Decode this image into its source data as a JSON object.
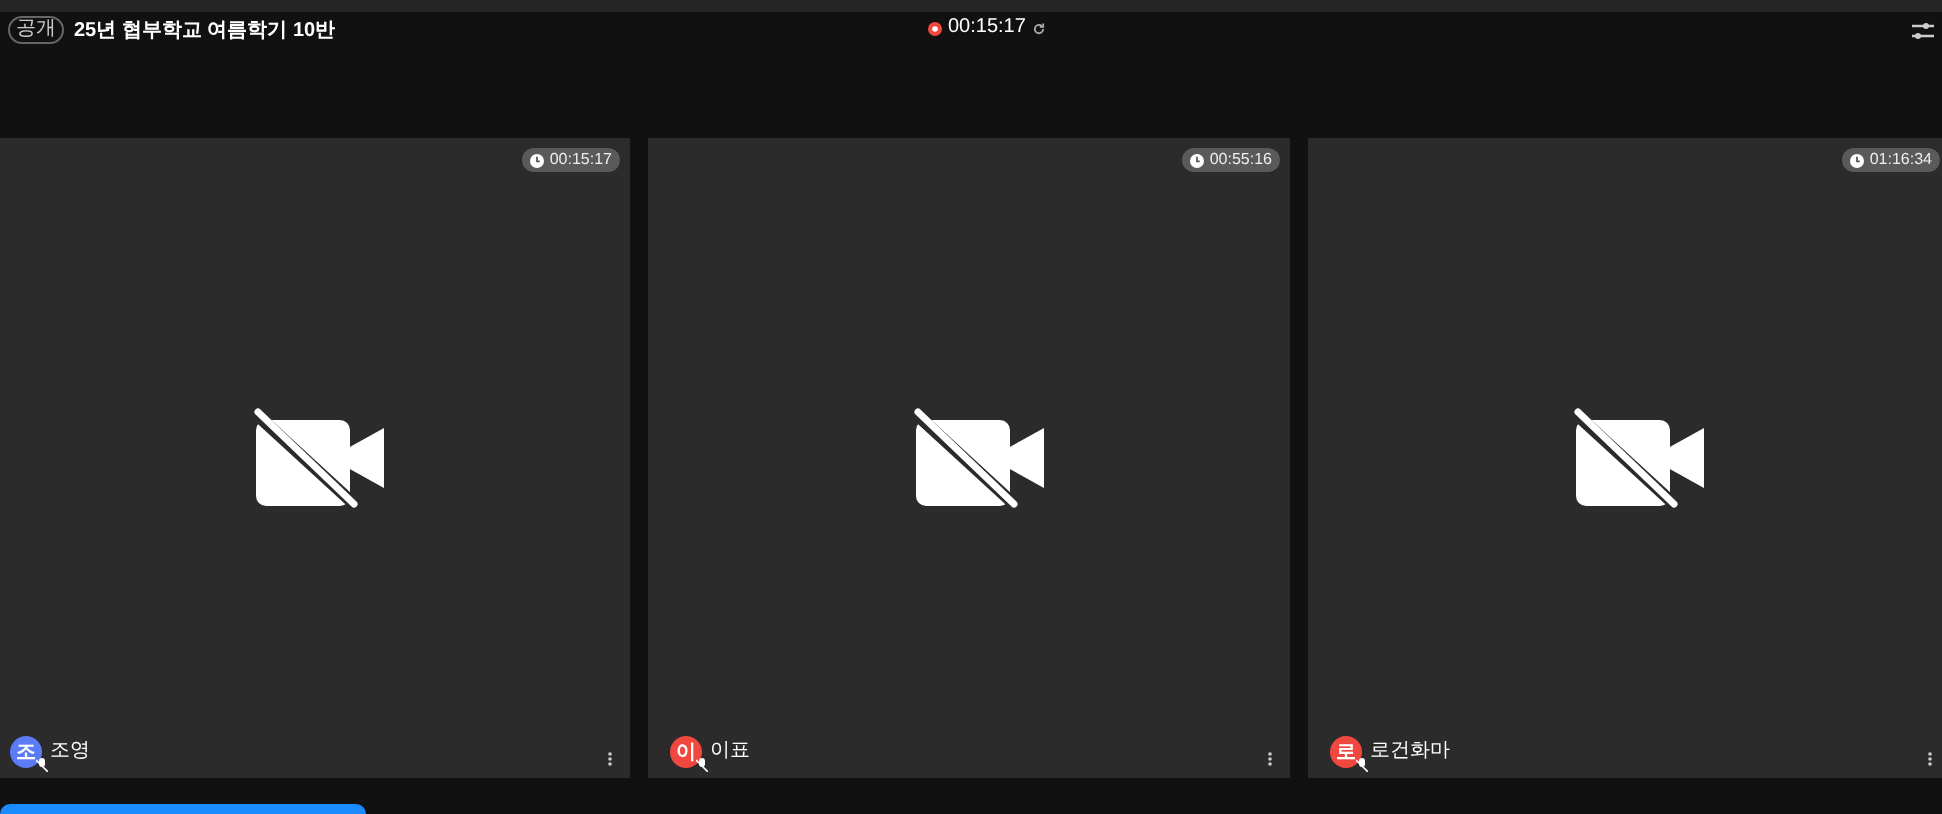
{
  "header": {
    "badge": "공개",
    "title": "25년 협부학교 여름학기 10반",
    "recording": {
      "on": true,
      "time": "00:15:17"
    }
  },
  "tiles": [
    {
      "timer": "00:15:17",
      "avatar": "조",
      "color": "#5b7cf5",
      "name": "조영"
    },
    {
      "timer": "00:55:16",
      "avatar": "이",
      "color": "#f0483e",
      "name": "이표"
    },
    {
      "timer": "01:16:34",
      "avatar": "로",
      "color": "#f0483e",
      "name": "로건화마"
    }
  ]
}
